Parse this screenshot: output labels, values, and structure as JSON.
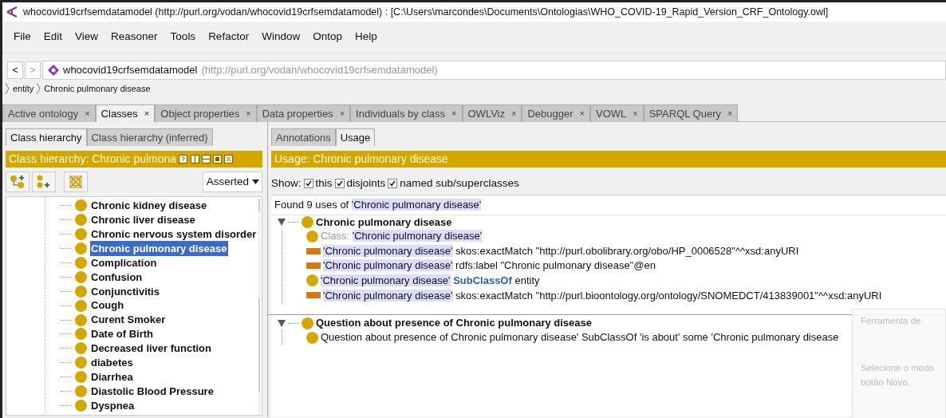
{
  "window": {
    "title": "whocovid19crfsemdatamodel (http://purl.org/vodan/whocovid19crfsemdatamodel) : [C:\\Users\\marcondes\\Documents\\Ontologias\\WHO_COVID-19_Rapid_Version_CRF_Ontology.owl]"
  },
  "menu": [
    "File",
    "Edit",
    "View",
    "Reasoner",
    "Tools",
    "Refactor",
    "Window",
    "Ontop",
    "Help"
  ],
  "address": {
    "back": "<",
    "forward": ">",
    "name": "whocovid19crfsemdatamodel",
    "iri": "(http://purl.org/vodan/whocovid19crfsemdatamodel)"
  },
  "breadcrumb": [
    "entity",
    "Chronic pulmonary disease"
  ],
  "tabs": [
    {
      "label": "Active ontology",
      "selected": false
    },
    {
      "label": "Classes",
      "selected": true
    },
    {
      "label": "Object properties",
      "selected": false
    },
    {
      "label": "Data properties",
      "selected": false
    },
    {
      "label": "Individuals by class",
      "selected": false
    },
    {
      "label": "OWLViz",
      "selected": false
    },
    {
      "label": "Debugger",
      "selected": false
    },
    {
      "label": "VOWL",
      "selected": false
    },
    {
      "label": "SPARQL Query",
      "selected": false
    }
  ],
  "tab_close": "×",
  "left": {
    "tabs": [
      {
        "label": "Class hierarchy",
        "selected": true
      },
      {
        "label": "Class hierarchy (inferred)",
        "selected": false
      }
    ],
    "header": "Class hierarchy: Chronic pulmona",
    "mode": "Asserted",
    "classes": [
      {
        "label": "Chronic kidney disease",
        "selected": false
      },
      {
        "label": "Chronic liver disease",
        "selected": false
      },
      {
        "label": "Chronic nervous system disorder",
        "selected": false
      },
      {
        "label": "Chronic pulmonary disease",
        "selected": true
      },
      {
        "label": "Complication",
        "selected": false
      },
      {
        "label": "Confusion",
        "selected": false
      },
      {
        "label": "Conjunctivitis",
        "selected": false
      },
      {
        "label": "Cough",
        "selected": false
      },
      {
        "label": "Curent Smoker",
        "selected": false
      },
      {
        "label": "Date of Birth",
        "selected": false
      },
      {
        "label": "Decreased liver function",
        "selected": false
      },
      {
        "label": "diabetes",
        "selected": false
      },
      {
        "label": "Diarrhea",
        "selected": false
      },
      {
        "label": "Diastolic Blood Pressure",
        "selected": false
      },
      {
        "label": "Dyspnea",
        "selected": false
      }
    ]
  },
  "right": {
    "tabs": [
      {
        "label": "Annotations",
        "selected": false
      },
      {
        "label": "Usage",
        "selected": true
      }
    ],
    "header": "Usage: Chronic pulmonary disease",
    "show_label": "Show:",
    "filters": [
      {
        "label": "this",
        "checked": true
      },
      {
        "label": "disjoints",
        "checked": true
      },
      {
        "label": "named sub/superclasses",
        "checked": true
      }
    ],
    "found_prefix": "Found 9 uses of",
    "found_subject": "'Chronic pulmonary disease'",
    "groups": [
      {
        "title": "Chronic pulmonary disease",
        "expanded": true,
        "entries": [
          {
            "kind": "declaration",
            "prefix": "Class:",
            "subject": "'Chronic pulmonary disease'"
          },
          {
            "kind": "annotation",
            "subject": "'Chronic pulmonary disease'",
            "rest": "skos:exactMatch \"http://purl.obolibrary.org/obo/HP_0006528\"^^xsd:anyURI"
          },
          {
            "kind": "annotation",
            "subject": "'Chronic pulmonary disease'",
            "rest": "rdfs:label \"Chronic pulmonary disease\"@en"
          },
          {
            "kind": "subclass",
            "subject": "'Chronic pulmonary disease'",
            "keyword": "SubClassOf",
            "rest": "entity"
          },
          {
            "kind": "annotation",
            "subject": "'Chronic pulmonary disease'",
            "rest": "skos:exactMatch \"http://purl.bioontology.org/ontology/SNOMEDCT/413839001\"^^xsd:anyURI"
          }
        ]
      },
      {
        "title": "Question about presence of Chronic pulmonary disease",
        "expanded": true,
        "entries": [
          {
            "kind": "axiom",
            "text": "Question about presence of Chronic pulmonary disease' SubClassOf 'is about' some 'Chronic pulmonary disease"
          }
        ]
      }
    ]
  },
  "overlay": {
    "title": "Ferramenta de",
    "lines": [
      "Selecione o modo",
      "botão Novo."
    ]
  }
}
